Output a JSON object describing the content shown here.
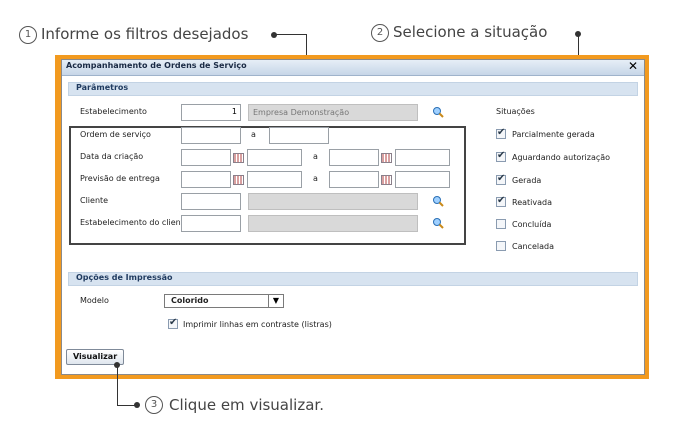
{
  "annotations": [
    {
      "number": "1",
      "text": "Informe os filtros desejados"
    },
    {
      "number": "2",
      "text": "Selecione a situação"
    },
    {
      "number": "3",
      "text": "Clique em visualizar."
    }
  ],
  "dialog": {
    "title": "Acompanhamento de Ordens de Serviço",
    "close_label": "✕"
  },
  "parametros": {
    "header": "Parâmetros",
    "estabelecimento_label": "Estabelecimento",
    "estabelecimento_value": "1",
    "estabelecimento_name": "Empresa Demonstração",
    "ordem_label": "Ordem de serviço",
    "data_criacao_label": "Data da criação",
    "previsao_label": "Previsão de entrega",
    "cliente_label": "Cliente",
    "estab_cliente_label": "Estabelecimento do cliente",
    "range_sep": "a"
  },
  "situacoes": {
    "label": "Situações",
    "items": [
      {
        "label": "Parcialmente gerada",
        "checked": true
      },
      {
        "label": "Aguardando autorização",
        "checked": true
      },
      {
        "label": "Gerada",
        "checked": true
      },
      {
        "label": "Reativada",
        "checked": true
      },
      {
        "label": "Concluída",
        "checked": false
      },
      {
        "label": "Cancelada",
        "checked": false
      }
    ]
  },
  "impressao": {
    "header": "Opções de Impressão",
    "modelo_label": "Modelo",
    "modelo_value": "Colorido",
    "linhas_label": "Imprimir linhas em contraste (listras)",
    "linhas_checked": true
  },
  "visualizar_label": "Visualizar",
  "colors": {
    "frame": "#f29a1f",
    "header_bg": "#d7e3f0"
  }
}
